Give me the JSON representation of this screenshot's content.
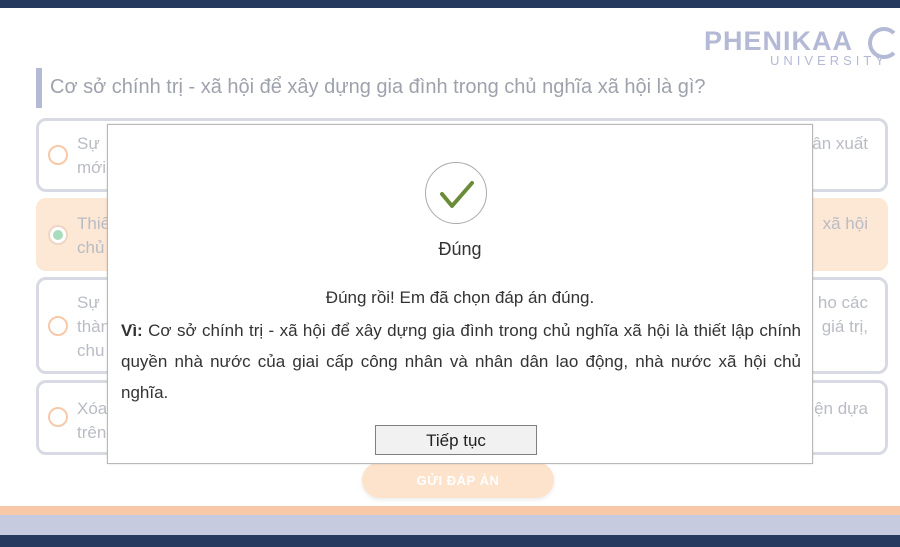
{
  "logo": {
    "name": "PHENIKAA",
    "sub": "UNIVERSITY"
  },
  "question": "Cơ sở chính trị - xã hội để xây dựng gia đình trong chủ nghĩa xã hội là gì?",
  "options": [
    {
      "left_lines": [
        "Sự",
        "mới"
      ],
      "right_lines": [
        "ân xuất"
      ],
      "selected": false
    },
    {
      "left_lines": [
        "Thiế",
        "chủ"
      ],
      "right_lines": [
        "xã hội"
      ],
      "selected": true
    },
    {
      "left_lines": [
        "Sự",
        "thàn",
        "chu"
      ],
      "right_lines": [
        "ho các",
        "giá trị,"
      ],
      "selected": false
    },
    {
      "left_lines": [
        "Xóa",
        "trên"
      ],
      "right_lines": [
        "ện dựa"
      ],
      "selected": false
    }
  ],
  "submit_label": "GỬI ĐÁP ÁN",
  "modal": {
    "icon": "checkmark-icon",
    "verdict": "Đúng",
    "message": "Đúng rồi! Em đã chọn đáp án đúng.",
    "reason_prefix": "Vì:",
    "reason_text": " Cơ sở chính trị - xã hội để xây dựng gia đình trong chủ nghĩa xã hội là thiết lập chính quyền nhà nước của giai cấp công nhân và nhân dân lao động, nhà nước xã hội chủ nghĩa.",
    "continue_label": "Tiếp tục"
  },
  "colors": {
    "navy": "#263a5f",
    "brand_lavender": "#b4b9d6",
    "selected_fill": "#fde7d5",
    "radio_border": "#f7c9a8",
    "check_green": "#6a8c38"
  }
}
